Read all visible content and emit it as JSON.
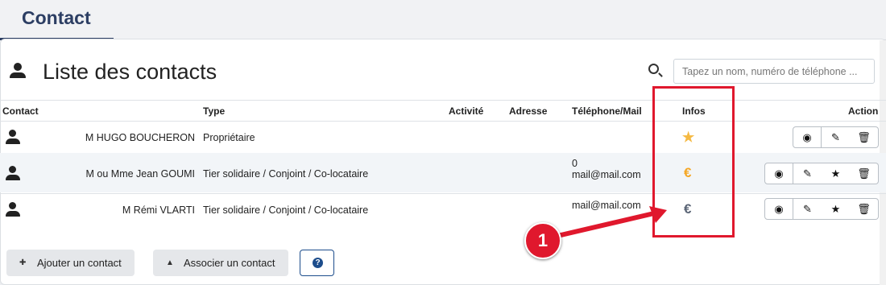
{
  "tab": {
    "label": "Contact"
  },
  "header": {
    "title": "Liste des contacts",
    "icon": "person-icon"
  },
  "search": {
    "placeholder": "Tapez un nom, numéro de téléphone ..."
  },
  "table": {
    "columns": {
      "contact": "Contact",
      "type": "Type",
      "activite": "Activité",
      "adresse": "Adresse",
      "telephone": "Téléphone/Mail",
      "infos": "Infos",
      "action": "Action"
    },
    "rows": [
      {
        "name": "M HUGO BOUCHERON",
        "type": "Propriétaire",
        "phone": "",
        "mail": "",
        "info_icon": "star-icon",
        "info_glyph": "★",
        "info_color": "#f5b942"
      },
      {
        "name": "M ou Mme Jean GOUMI",
        "type": "Tier solidaire / Conjoint / Co-locataire",
        "phone": "0",
        "mail": "mail@mail.com",
        "info_icon": "euro-icon",
        "info_glyph": "€",
        "info_color": "#f5a623"
      },
      {
        "name": "M Rémi VLARTI",
        "type": "Tier solidaire / Conjoint / Co-locataire",
        "phone": "",
        "mail": "mail@mail.com",
        "info_icon": "euro-icon",
        "info_glyph": "€",
        "info_color": "#5a6475"
      }
    ]
  },
  "buttons": {
    "add_contact": "Ajouter un contact",
    "associate_contact": "Associer un contact",
    "help": "?"
  },
  "annotation": {
    "number": "1",
    "color": "#e0182d"
  }
}
